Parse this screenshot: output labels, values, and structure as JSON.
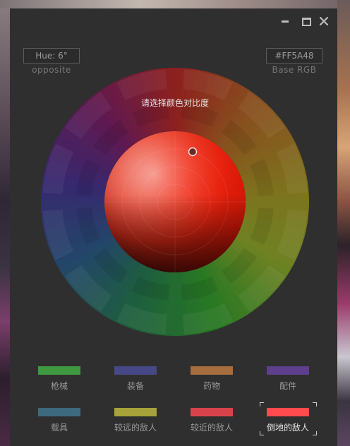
{
  "window": {
    "minimize_icon": "minimize-icon",
    "maximize_icon": "maximize-icon",
    "close_icon": "close-icon"
  },
  "hue": {
    "value": "Hue: 6°",
    "caption": "opposite"
  },
  "base": {
    "value": "#FF5A48",
    "caption": "Base RGB"
  },
  "wheel": {
    "title": "请选择颜色对比度",
    "base_color": "#FF5A48",
    "picker_marker": "picker-marker"
  },
  "swatches": [
    {
      "label": "枪械",
      "color": "#3f9940",
      "selected": false
    },
    {
      "label": "装备",
      "color": "#474887",
      "selected": false
    },
    {
      "label": "药物",
      "color": "#a66d3e",
      "selected": false
    },
    {
      "label": "配件",
      "color": "#5e3f8e",
      "selected": false
    },
    {
      "label": "载具",
      "color": "#3d6a7f",
      "selected": false
    },
    {
      "label": "较远的敌人",
      "color": "#a7a23a",
      "selected": false
    },
    {
      "label": "较近的敌人",
      "color": "#d8434b",
      "selected": false
    },
    {
      "label": "倒地的敌人",
      "color": "#ff4a4e",
      "selected": true
    }
  ]
}
